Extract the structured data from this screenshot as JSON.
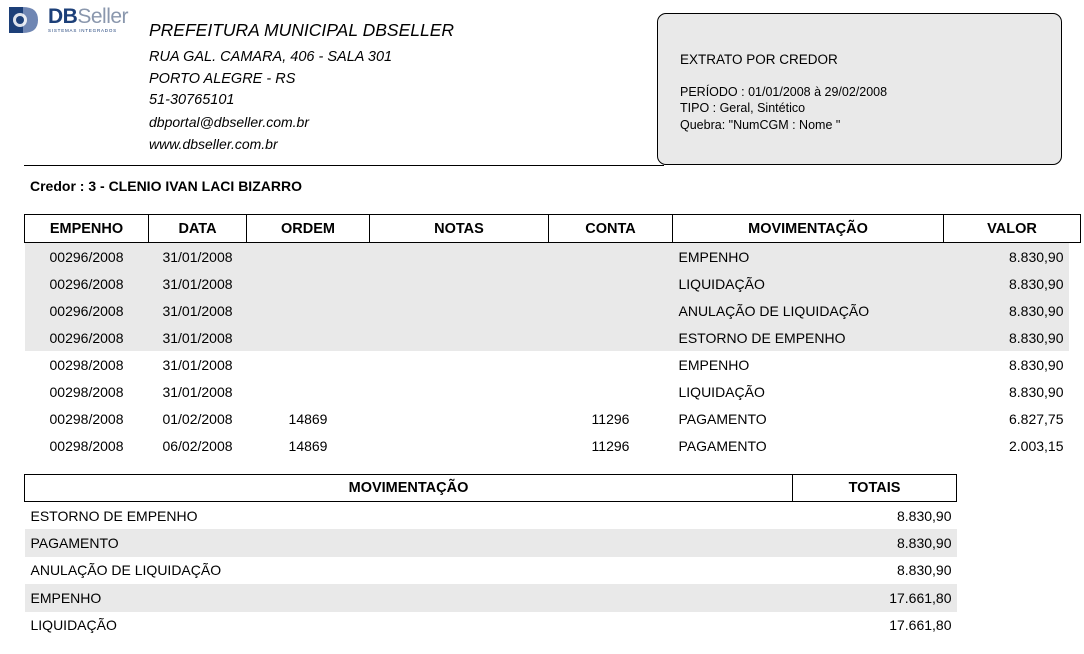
{
  "logo": {
    "brand_db": "DB",
    "brand_seller": "Seller",
    "tagline": "SISTEMAS INTEGRADOS"
  },
  "org": {
    "name": "PREFEITURA MUNICIPAL DBSELLER",
    "address": "RUA GAL. CAMARA, 406 - SALA 301",
    "city": "PORTO ALEGRE - RS",
    "phone": "51-30765101",
    "email": "dbportal@dbseller.com.br",
    "website": "www.dbseller.com.br"
  },
  "report": {
    "title": "EXTRATO POR CREDOR",
    "periodo": "PERÍODO : 01/01/2008 à 29/02/2008",
    "tipo": "TIPO :  Geral, Sintético",
    "quebra": "Quebra: \"NumCGM : Nome \""
  },
  "credor": "Credor : 3 - CLENIO IVAN LACI BIZARRO",
  "movements": {
    "headers": [
      "EMPENHO",
      "DATA",
      "ORDEM",
      "NOTAS",
      "CONTA",
      "MOVIMENTAÇÃO",
      "VALOR"
    ],
    "rows": [
      {
        "empenho": "00296/2008",
        "data": "31/01/2008",
        "ordem": "",
        "notas": "",
        "conta": "",
        "movimentacao": "EMPENHO",
        "valor": "8.830,90",
        "shaded": true
      },
      {
        "empenho": "00296/2008",
        "data": "31/01/2008",
        "ordem": "",
        "notas": "",
        "conta": "",
        "movimentacao": "LIQUIDAÇÃO",
        "valor": "8.830,90",
        "shaded": true
      },
      {
        "empenho": "00296/2008",
        "data": "31/01/2008",
        "ordem": "",
        "notas": "",
        "conta": "",
        "movimentacao": "ANULAÇÃO DE LIQUIDAÇÃO",
        "valor": "8.830,90",
        "shaded": true
      },
      {
        "empenho": "00296/2008",
        "data": "31/01/2008",
        "ordem": "",
        "notas": "",
        "conta": "",
        "movimentacao": "ESTORNO DE EMPENHO",
        "valor": "8.830,90",
        "shaded": true
      },
      {
        "empenho": "00298/2008",
        "data": "31/01/2008",
        "ordem": "",
        "notas": "",
        "conta": "",
        "movimentacao": "EMPENHO",
        "valor": "8.830,90",
        "shaded": false
      },
      {
        "empenho": "00298/2008",
        "data": "31/01/2008",
        "ordem": "",
        "notas": "",
        "conta": "",
        "movimentacao": "LIQUIDAÇÃO",
        "valor": "8.830,90",
        "shaded": false
      },
      {
        "empenho": "00298/2008",
        "data": "01/02/2008",
        "ordem": "14869",
        "notas": "",
        "conta": "11296",
        "movimentacao": "PAGAMENTO",
        "valor": "6.827,75",
        "shaded": false
      },
      {
        "empenho": "00298/2008",
        "data": "06/02/2008",
        "ordem": "14869",
        "notas": "",
        "conta": "11296",
        "movimentacao": "PAGAMENTO",
        "valor": "2.003,15",
        "shaded": false
      }
    ]
  },
  "totals": {
    "headers": [
      "MOVIMENTAÇÃO",
      "TOTAIS"
    ],
    "rows": [
      {
        "movimentacao": "ESTORNO DE EMPENHO",
        "total": "8.830,90",
        "shaded": false
      },
      {
        "movimentacao": "PAGAMENTO",
        "total": "8.830,90",
        "shaded": true
      },
      {
        "movimentacao": "ANULAÇÃO DE LIQUIDAÇÃO",
        "total": "8.830,90",
        "shaded": false
      },
      {
        "movimentacao": "EMPENHO",
        "total": "17.661,80",
        "shaded": true
      },
      {
        "movimentacao": "LIQUIDAÇÃO",
        "total": "17.661,80",
        "shaded": false
      }
    ]
  },
  "colors": {
    "shade": "#e9e9e9",
    "logo_blue": "#1c3f78",
    "logo_grey": "#8a97ad"
  }
}
